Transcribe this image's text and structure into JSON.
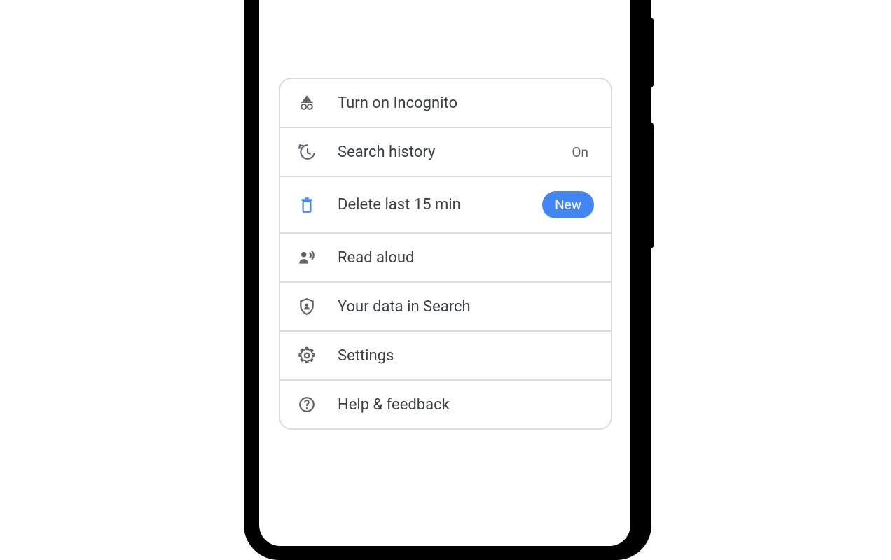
{
  "menu": {
    "items": [
      {
        "label": "Turn on Incognito"
      },
      {
        "label": "Search history",
        "status": "On"
      },
      {
        "label": "Delete last 15 min",
        "badge": "New"
      },
      {
        "label": "Read aloud"
      },
      {
        "label": "Your data in Search"
      },
      {
        "label": "Settings"
      },
      {
        "label": "Help & feedback"
      }
    ]
  },
  "colors": {
    "accent": "#4285f4",
    "text": "#3c4043",
    "secondary": "#5f6368",
    "border": "#dadce0"
  }
}
